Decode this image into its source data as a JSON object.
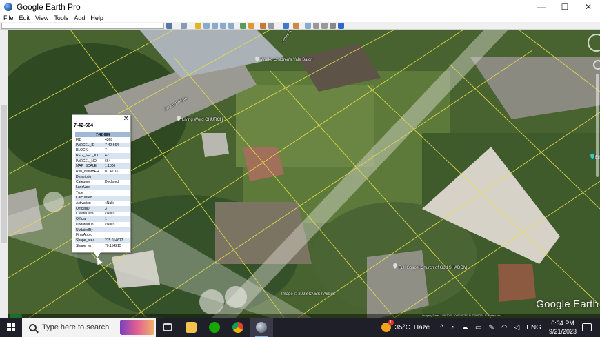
{
  "window": {
    "title": "Google Earth Pro",
    "minimize": "—",
    "maximize": "☐",
    "close": "✕"
  },
  "menubar": {
    "items": [
      "File",
      "Edit",
      "View",
      "Tools",
      "Add",
      "Help"
    ]
  },
  "toolbar": {
    "search_value": ""
  },
  "map": {
    "labels": {
      "road_top": "Jenes Rd",
      "road_mid": "Jenes Rd/Cur",
      "place_top": "Wreko Children's Yale Salon",
      "church_left": "Living Word CHURCH",
      "church_right": "Full Gospel Church of God SHADOM",
      "right_edge": "Eli"
    },
    "attribution": "Image © 2023 CNES / Airbus",
    "watermark": "Google Earth",
    "status_text": "Imagery Date: 1/26/2021   1095°05'37\" N  7°3850'31.5\" E  elev 1m"
  },
  "balloon": {
    "title": "7-42-664",
    "close": "✕",
    "header": "7-42-664",
    "rows": [
      {
        "k": "FID",
        "v": "4368"
      },
      {
        "k": "PARCEL_ID",
        "v": "7-42-664"
      },
      {
        "k": "BLOCK",
        "v": "7"
      },
      {
        "k": "REG_SEC_ID",
        "v": "42"
      },
      {
        "k": "PARCEL_NO",
        "v": "664"
      },
      {
        "k": "MAP_SCALE",
        "v": "1:1000"
      },
      {
        "k": "RIM_NUMBER",
        "v": "07 42 16"
      },
      {
        "k": "Descriptio",
        "v": ""
      },
      {
        "k": "Category",
        "v": "Declared"
      },
      {
        "k": "LandUse",
        "v": ""
      },
      {
        "k": "Type",
        "v": ""
      },
      {
        "k": "Calculated",
        "v": ""
      },
      {
        "k": "Activation",
        "v": "<Null>"
      },
      {
        "k": "OfficerID",
        "v": "3"
      },
      {
        "k": "CreateDate",
        "v": "<Null>"
      },
      {
        "k": "Official",
        "v": "1"
      },
      {
        "k": "UpdatedOn",
        "v": "<Null>"
      },
      {
        "k": "UpdatedBy",
        "v": ""
      },
      {
        "k": "FinalAppro",
        "v": ""
      },
      {
        "k": "Shape_area",
        "v": "275.014617"
      },
      {
        "k": "Shape_len",
        "v": "70.154215"
      }
    ]
  },
  "taskbar": {
    "search_placeholder": "Type here to search",
    "apps": [
      "task-view",
      "file-explorer",
      "upwork",
      "chrome",
      "google-earth"
    ],
    "weather_temp": "35°C",
    "weather_desc": "Haze",
    "weather_badge": "1",
    "language": "ENG",
    "time": "6:34 PM",
    "date": "9/21/2023"
  },
  "colors": {
    "parcel_line": "#e8e04a",
    "balloon_header": "#9fb8d8",
    "balloon_alt_row": "#d9e4f2",
    "taskbar_bg": "#1f1f2a"
  }
}
